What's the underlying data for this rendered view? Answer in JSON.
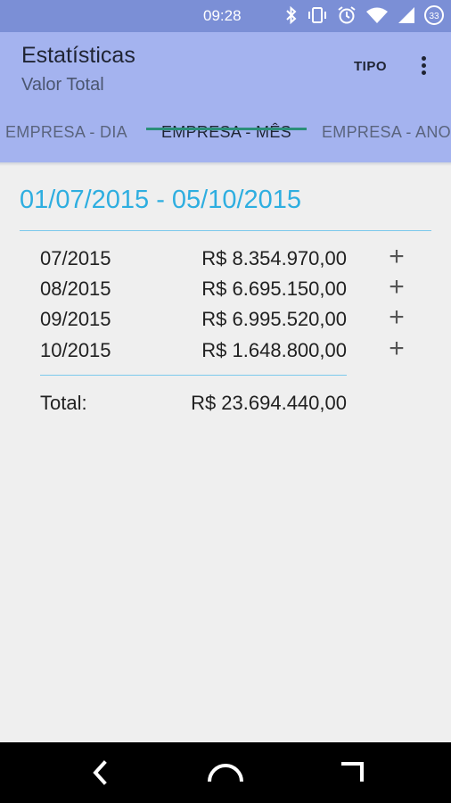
{
  "status_bar": {
    "time": "09:28",
    "icons": [
      "bluetooth-icon",
      "vibrate-icon",
      "alarm-icon",
      "wifi-icon",
      "signal-icon",
      "battery-icon"
    ],
    "battery": "33"
  },
  "app_bar": {
    "title": "Estatísticas",
    "subtitle": "Valor Total",
    "action_label": "TIPO",
    "overflow_icon": "more-vert-icon"
  },
  "tabs": [
    {
      "label": "EMPRESA - DIA",
      "active": false
    },
    {
      "label": "EMPRESA - MÊS",
      "active": true
    },
    {
      "label": "EMPRESA - ANO",
      "active": false
    }
  ],
  "content": {
    "date_range": "01/07/2015 - 05/10/2015",
    "rows": [
      {
        "month": "07/2015",
        "amount": "R$ 8.354.970,00"
      },
      {
        "month": "08/2015",
        "amount": "R$ 6.695.150,00"
      },
      {
        "month": "09/2015",
        "amount": "R$ 6.995.520,00"
      },
      {
        "month": "10/2015",
        "amount": "R$ 1.648.800,00"
      }
    ],
    "expand_icon": "+",
    "total_label": "Total:",
    "total_value": "R$ 23.694.440,00"
  },
  "nav_bar": {
    "icons": [
      "back-icon",
      "home-icon",
      "recents-icon"
    ]
  },
  "colors": {
    "status_bar": "#7b8fd6",
    "app_bar": "#a4b3ef",
    "accent": "#2eaee0",
    "tab_indicator": "#2a8f79"
  }
}
